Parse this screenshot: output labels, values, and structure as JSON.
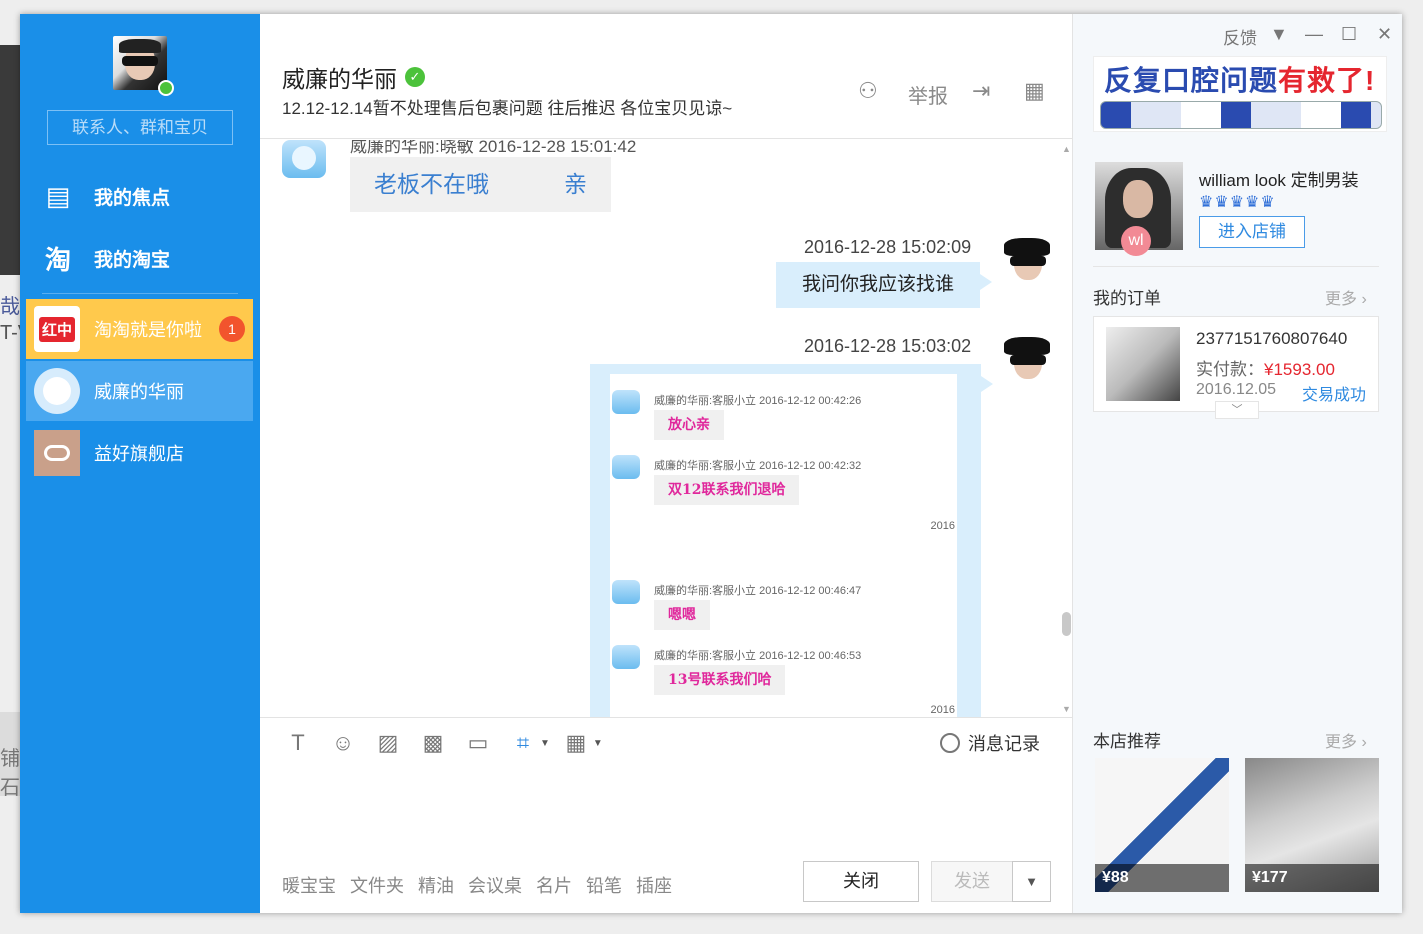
{
  "desktop": {
    "left_text_1": "哉 /",
    "left_text_2": "T-V",
    "left_text_3": "铺石"
  },
  "sidebar": {
    "search_placeholder": "联系人、群和宝贝",
    "nav": [
      {
        "label": "我的焦点",
        "icon": "news-panel-icon",
        "glyph": "▤"
      },
      {
        "label": "我的淘宝",
        "icon": "taobao-logo-icon",
        "glyph": "淘"
      }
    ],
    "contacts": [
      {
        "name": "淘淘就是你啦",
        "badge": "1",
        "avatar_text": "红中",
        "state": "highlighted"
      },
      {
        "name": "威廉的华丽",
        "state": "active"
      },
      {
        "name": "益好旗舰店",
        "state": "normal"
      }
    ]
  },
  "header": {
    "title": "威廉的华丽",
    "verified_glyph": "✓",
    "subtitle": "12.12-12.14暂不处理售后包裹问题 往后推迟 各位宝贝见谅~",
    "report_label": "举报",
    "icons": {
      "add_contact": "add-friend-icon",
      "export": "export-icon",
      "apps": "apps-grid-icon"
    },
    "add_glyph": "⚇",
    "export_glyph": "⇥",
    "apps_glyph": "▦"
  },
  "messages": {
    "cut_meta": "威廉的华丽:晓敏    2016-12-28 15:01:42",
    "incoming_text": "老板不在哦",
    "incoming_suffix": "亲",
    "out_1": {
      "timestamp": "2016-12-28 15:02:09",
      "text": "我问你我应该找谁"
    },
    "out_2": {
      "timestamp": "2016-12-28 15:03:02"
    },
    "screenshot": {
      "rows": [
        {
          "meta": "威廉的华丽:客服小立    2016-12-12 00:42:26",
          "text": "放心亲"
        },
        {
          "meta": "威廉的华丽:客服小立    2016-12-12 00:42:32",
          "text": "双12联系我们退哈"
        },
        {
          "meta": "威廉的华丽:客服小立    2016-12-12 00:46:47",
          "text": "嗯嗯"
        },
        {
          "meta": "威廉的华丽:客服小立    2016-12-12 00:46:53",
          "text": "13号联系我们哈"
        }
      ],
      "ts_1": "2016",
      "ts_2": "2016"
    }
  },
  "scrollbar": {
    "up": "▲",
    "down": "▼"
  },
  "input": {
    "tools": [
      {
        "icon": "text-format-icon",
        "glyph": "T"
      },
      {
        "icon": "emoji-icon",
        "glyph": "☺"
      },
      {
        "icon": "image-icon",
        "glyph": "▨"
      },
      {
        "icon": "magic-expression-icon",
        "glyph": "▩"
      },
      {
        "icon": "comment-icon",
        "glyph": "▭"
      },
      {
        "icon": "crop-screenshot-icon",
        "glyph": "⌗"
      },
      {
        "icon": "calculator-icon",
        "glyph": "▦"
      }
    ],
    "caret": "▼",
    "history_label": "消息记录",
    "quick_words": [
      "暖宝宝",
      "文件夹",
      "精油",
      "会议桌",
      "名片",
      "铅笔",
      "插座"
    ],
    "close_label": "关闭",
    "send_label": "发送",
    "send_dropdown": "▼"
  },
  "right_panel": {
    "window_controls": {
      "feedback": "反馈",
      "menu": "▼",
      "minimize": "—",
      "maximize": "☐",
      "close": "✕"
    },
    "ad": {
      "title_blue": "反复口腔问题",
      "title_red": "有救了!"
    },
    "shop": {
      "name": "william look 定制男装",
      "crowns": "♛♛♛♛♛",
      "avatar_badge": "wl",
      "enter_label": "进入店铺"
    },
    "orders": {
      "title": "我的订单",
      "more": "更多 ›",
      "item": {
        "id": "2377151760807640",
        "paid_label": "实付款：",
        "price": "¥1593.00",
        "date": "2016.12.05",
        "status": "交易成功"
      },
      "expand": "﹀"
    },
    "recommend": {
      "title": "本店推荐",
      "more": "更多 ›",
      "items": [
        {
          "price": "¥88"
        },
        {
          "price": "¥177"
        }
      ]
    }
  },
  "colors": {
    "sidebar": "#1a8fe8",
    "highlight": "#ffc94c",
    "accent": "#2f8ae0",
    "price_red": "#e5262f",
    "screenshot_text": "#e0289c"
  }
}
